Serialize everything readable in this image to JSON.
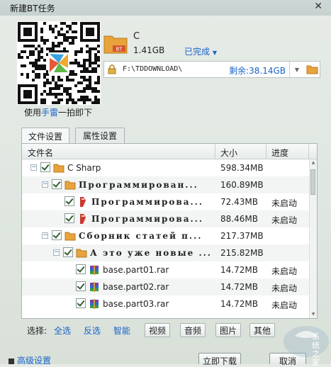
{
  "window": {
    "title": "新建BT任务"
  },
  "qr": {
    "caption_prefix": "使用",
    "caption_accent": "手雷",
    "caption_suffix": "一拍即下"
  },
  "file": {
    "name": "C",
    "size": "1.41GB",
    "status": "已完成",
    "bt_badge": "BT"
  },
  "path": {
    "value": "F:\\TDDOWNLOAD\\",
    "free": "剩余:38.14GB"
  },
  "tabs": [
    {
      "label": "文件设置"
    },
    {
      "label": "属性设置"
    }
  ],
  "columns": {
    "name": "文件名",
    "size": "大小",
    "progress": "进度"
  },
  "rows": [
    {
      "name": "C Sharp",
      "size": "598.34MB",
      "progress": ""
    },
    {
      "name": "Программирован...",
      "size": "160.89MB",
      "progress": ""
    },
    {
      "name": "Программирова...",
      "size": "72.43MB",
      "progress": "未启动"
    },
    {
      "name": "Программирова...",
      "size": "88.46MB",
      "progress": "未启动"
    },
    {
      "name": "Сборник статей п...",
      "size": "217.37MB",
      "progress": ""
    },
    {
      "name": "А это уже новые ...",
      "size": "215.82MB",
      "progress": ""
    },
    {
      "name": "base.part01.rar",
      "size": "14.72MB",
      "progress": "未启动"
    },
    {
      "name": "base.part02.rar",
      "size": "14.72MB",
      "progress": "未启动"
    },
    {
      "name": "base.part03.rar",
      "size": "14.72MB",
      "progress": "未启动"
    }
  ],
  "filter": {
    "label": "选择:",
    "links": [
      "全选",
      "反选",
      "智能"
    ],
    "buttons": [
      "视频",
      "音频",
      "图片",
      "其他"
    ]
  },
  "bottom": {
    "link": "高级设置",
    "download": "立即下载",
    "cancel": "取消"
  },
  "watermark": {
    "text": "系统之家"
  },
  "colors": {
    "accent": "#1a63c8",
    "bt_badge": "#d9542b",
    "folder": "#e8a33d"
  }
}
